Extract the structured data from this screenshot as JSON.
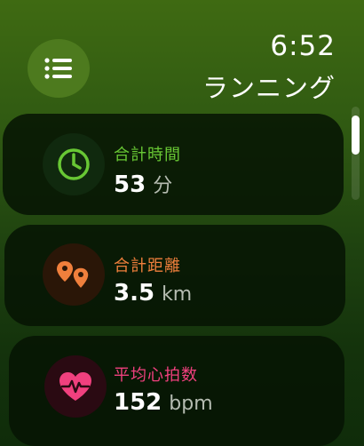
{
  "status": {
    "time": "6:52"
  },
  "header": {
    "title": "ランニング",
    "menu_icon": "list-icon"
  },
  "metrics": [
    {
      "label": "合計時間",
      "value": "53",
      "unit": "分",
      "icon": "clock-icon",
      "color": "#68c734"
    },
    {
      "label": "合計距離",
      "value": "3.5",
      "unit": "km",
      "icon": "map-pins-icon",
      "color": "#ef7f3c"
    },
    {
      "label": "平均心拍数",
      "value": "152",
      "unit": "bpm",
      "icon": "heart-rate-icon",
      "color": "#f0407e"
    }
  ],
  "colors": {
    "background_top": "#3f6a12",
    "background_bottom": "#0f2c0a",
    "menu_button": "#4d7a1e"
  }
}
